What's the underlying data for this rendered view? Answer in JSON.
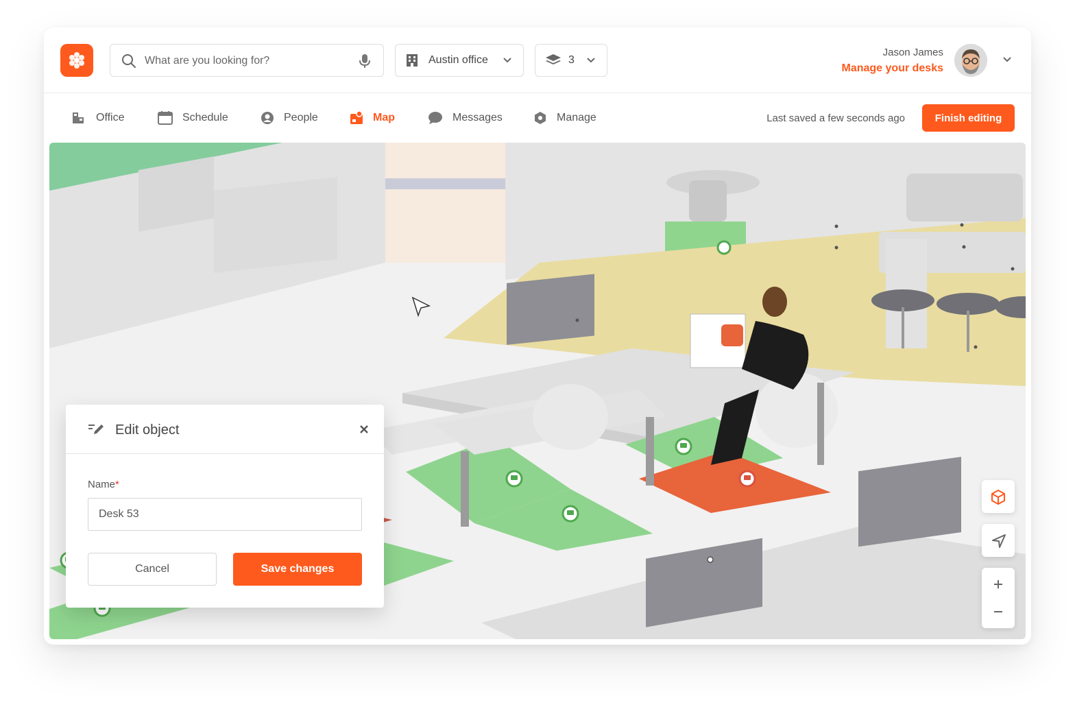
{
  "brand": {
    "accent": "#fe5a1d",
    "logo_icon": "flower-logo-icon"
  },
  "search": {
    "placeholder": "What are you looking for?",
    "icon": "search-icon",
    "mic_icon": "microphone-icon"
  },
  "office_selector": {
    "value": "Austin office",
    "icon": "building-icon"
  },
  "floor_selector": {
    "value": "3",
    "icon": "layers-icon"
  },
  "user": {
    "name": "Jason James",
    "link": "Manage your desks"
  },
  "nav": {
    "items": [
      {
        "label": "Office",
        "icon": "office-icon",
        "active": false
      },
      {
        "label": "Schedule",
        "icon": "calendar-icon",
        "active": false
      },
      {
        "label": "People",
        "icon": "person-icon",
        "active": false
      },
      {
        "label": "Map",
        "icon": "map-icon",
        "active": true
      },
      {
        "label": "Messages",
        "icon": "chat-icon",
        "active": false
      },
      {
        "label": "Manage",
        "icon": "hexagon-icon",
        "active": false
      }
    ],
    "saved_status": "Last saved a few seconds ago",
    "finish_label": "Finish editing"
  },
  "edit_panel": {
    "title": "Edit object",
    "name_label": "Name",
    "required_mark": "*",
    "name_value": "Desk 53",
    "cancel_label": "Cancel",
    "save_label": "Save changes"
  },
  "map": {
    "desk_status_colors": {
      "available": "#8ed48e",
      "booked": "#c9574a",
      "selected": "#e8643b",
      "zone": "#e9dca0"
    },
    "controls": [
      "cube-3d-icon",
      "locate-arrow-icon",
      "zoom-in-icon",
      "zoom-out-icon"
    ]
  }
}
